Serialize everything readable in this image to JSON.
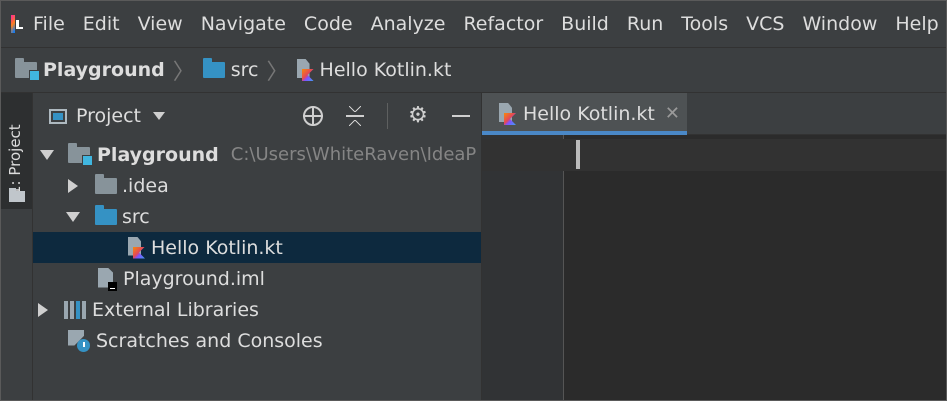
{
  "menu": {
    "items": [
      "File",
      "Edit",
      "View",
      "Navigate",
      "Code",
      "Analyze",
      "Refactor",
      "Build",
      "Run",
      "Tools",
      "VCS",
      "Window",
      "Help"
    ]
  },
  "navbar": {
    "crumbs": [
      "Playground",
      "src",
      "Hello Kotlin.kt"
    ]
  },
  "toolstrip": {
    "project_tab_label": "1: Project"
  },
  "project_panel": {
    "title": "Project",
    "tree": [
      {
        "label": "Playground",
        "path": "C:\\Users\\WhiteRaven\\IdeaP",
        "state": "expanded",
        "icon": "module-folder-icon"
      },
      {
        "label": ".idea",
        "state": "collapsed",
        "icon": "folder-icon"
      },
      {
        "label": "src",
        "state": "expanded",
        "icon": "source-folder-icon"
      },
      {
        "label": "Hello Kotlin.kt",
        "state": "leaf",
        "icon": "kotlin-file-icon",
        "selected": true
      },
      {
        "label": "Playground.iml",
        "state": "leaf",
        "icon": "iml-file-icon"
      },
      {
        "label": "External Libraries",
        "state": "collapsed",
        "icon": "libraries-icon"
      },
      {
        "label": "Scratches and Consoles",
        "state": "leaf",
        "icon": "scratches-icon"
      }
    ]
  },
  "editor": {
    "tabs": [
      {
        "label": "Hello Kotlin.kt",
        "close_glyph": "✕",
        "active": true
      }
    ],
    "content": ""
  },
  "colors": {
    "menubar_bg": "#3c3f41",
    "editor_bg": "#2b2b2b",
    "selection_bg": "#0d293e",
    "active_tab_underline": "#4a88c7",
    "module_badge": "#40b6e0",
    "source_folder": "#3592c4"
  }
}
